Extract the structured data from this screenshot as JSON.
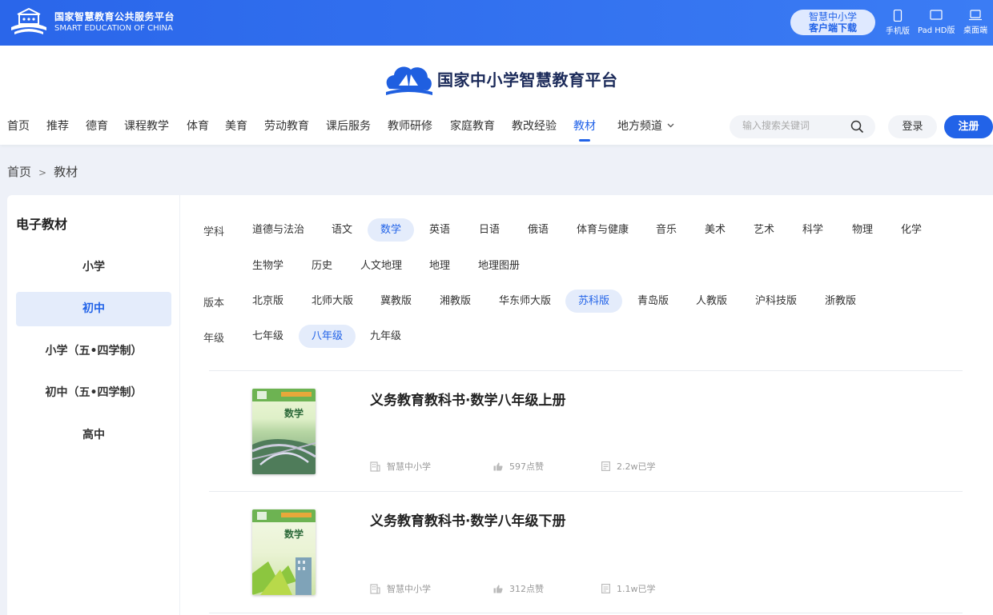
{
  "topbar": {
    "brand_cn": "国家智慧教育公共服务平台",
    "brand_en": "SMART EDUCATION OF CHINA",
    "download_line1": "智慧中小学",
    "download_line2": "客户端下载",
    "devices": [
      "手机版",
      "Pad HD版",
      "桌面端"
    ]
  },
  "header": {
    "site_title": "国家中小学智慧教育平台",
    "nav": [
      "首页",
      "推荐",
      "德育",
      "课程教学",
      "体育",
      "美育",
      "劳动教育",
      "课后服务",
      "教师研修",
      "家庭教育",
      "教改经验",
      "教材",
      "地方频道"
    ],
    "active_nav": "教材",
    "search_placeholder": "输入搜索关键词",
    "login": "登录",
    "register": "注册"
  },
  "breadcrumb": {
    "home": "首页",
    "sep": ">",
    "current": "教材"
  },
  "sidebar": {
    "title": "电子教材",
    "items": [
      "小学",
      "初中",
      "小学（五•四学制）",
      "初中（五•四学制）",
      "高中"
    ],
    "active": "初中"
  },
  "filters": {
    "subject_label": "学科",
    "subjects_row1": [
      "道德与法治",
      "语文",
      "数学",
      "英语",
      "日语",
      "俄语",
      "体育与健康",
      "音乐",
      "美术",
      "艺术",
      "科学",
      "物理",
      "化学"
    ],
    "subjects_row2": [
      "生物学",
      "历史",
      "人文地理",
      "地理",
      "地理图册"
    ],
    "active_subject": "数学",
    "edition_label": "版本",
    "editions": [
      "北京版",
      "北师大版",
      "冀教版",
      "湘教版",
      "华东师大版",
      "苏科版",
      "青岛版",
      "人教版",
      "沪科技版",
      "浙教版"
    ],
    "active_edition": "苏科版",
    "grade_label": "年级",
    "grades": [
      "七年级",
      "八年级",
      "九年级"
    ],
    "active_grade": "八年级"
  },
  "books": [
    {
      "title": "义务教育教科书·数学八年级上册",
      "source": "智慧中小学",
      "likes": "597点赞",
      "learners": "2.2w已学",
      "cover_title": "数学"
    },
    {
      "title": "义务教育教科书·数学八年级下册",
      "source": "智慧中小学",
      "likes": "312点赞",
      "learners": "1.1w已学",
      "cover_title": "数学"
    }
  ],
  "colors": {
    "brand_blue": "#2263e8",
    "topbar_blue": "#2d6cf0",
    "chip_active_bg": "#e4ecfb"
  }
}
